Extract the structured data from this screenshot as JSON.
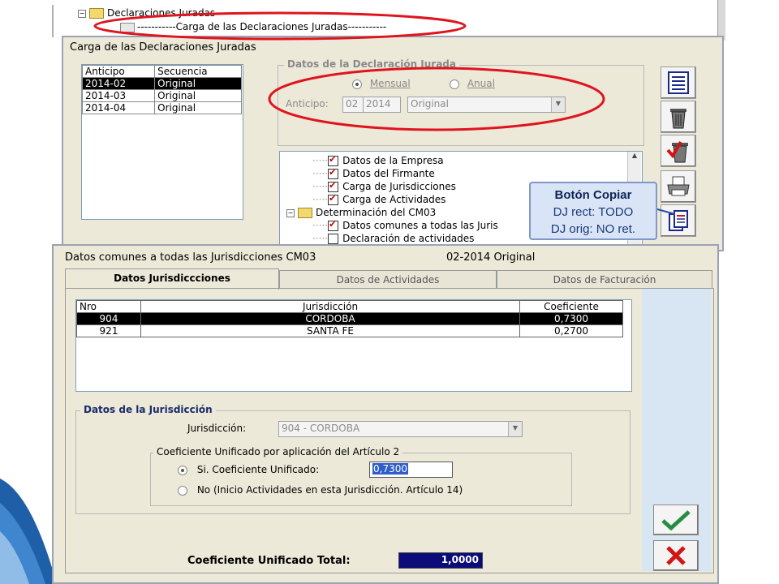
{
  "tree_top": {
    "item1": "Declaraciones Juradas",
    "item2": "-----------Carga de las Declaraciones Juradas-----------"
  },
  "window1": {
    "title": "Carga de las Declaraciones Juradas",
    "grid": {
      "headers": [
        "Anticipo",
        "Secuencia"
      ],
      "rows": [
        {
          "anticipo": "2014-02",
          "secuencia": "Original"
        },
        {
          "anticipo": "2014-03",
          "secuencia": "Original"
        },
        {
          "anticipo": "2014-04",
          "secuencia": "Original"
        }
      ]
    },
    "dj_group": {
      "title": "Datos de la Declaración Jurada",
      "radio_mensual": "Mensual",
      "radio_anual": "Anual",
      "anticipo_label": "Anticipo:",
      "anticipo_month": "02",
      "anticipo_year": "2014",
      "secuencia_value": "Original"
    },
    "tree": {
      "items": [
        "Datos de la Empresa",
        "Datos del Firmante",
        "Carga de Jurisdicciones",
        "Carga de Actividades",
        "Determinación del CM03",
        "Datos comunes a todas las Juris",
        "Declaración de actividades"
      ]
    }
  },
  "callout": {
    "title": "Botón Copiar",
    "line1": "DJ rect: TODO",
    "line2": "DJ orig: NO ret."
  },
  "window2": {
    "title": "Datos comunes a todas las Jurisdicciones CM03",
    "period": "02-2014 Original",
    "tabs": [
      "Datos Jurisdiccciones",
      "Datos de Actividades",
      "Datos de Facturación"
    ],
    "grid": {
      "headers": [
        "Nro",
        "Jurisdicción",
        "Coeficiente"
      ],
      "rows": [
        {
          "nro": "904",
          "jurisdiccion": "CORDOBA",
          "coeficiente": "0,7300"
        },
        {
          "nro": "921",
          "jurisdiccion": "SANTA FE",
          "coeficiente": "0,2700"
        }
      ]
    },
    "jur_group": {
      "title": "Datos de la Jurisdicción",
      "label": "Jurisdicción:",
      "value": "904 - CORDOBA"
    },
    "coef_group": {
      "title": "Coeficiente Unificado por aplicación del Artículo 2",
      "opt_si": "Si. Coeficiente Unificado:",
      "opt_si_value": "0,7300",
      "opt_no": "No (Inicio Actividades en esta Jurisdicción. Artículo 14)"
    },
    "total_label": "Coeficiente Unificado Total:",
    "total_value": "1,0000"
  },
  "colors": {
    "annotation_red": "#e0141e",
    "selection_bg": "#000000",
    "total_bg": "#0b0b7a",
    "ok_green": "#2e9a2e",
    "cancel_red": "#d21414"
  }
}
